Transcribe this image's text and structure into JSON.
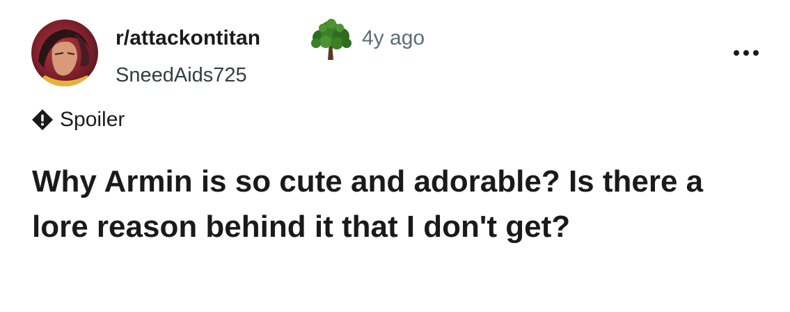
{
  "post": {
    "subreddit": "r/attackontitan",
    "flair_icon": "tree-icon",
    "age": "4y ago",
    "author": "SneedAids725",
    "menu_icon": "more-options-icon",
    "tag": {
      "icon": "exclamation-icon",
      "label": "Spoiler"
    },
    "title": "Why Armin is so cute and adorable? Is there a lore reason behind it that I don't get?"
  },
  "colors": {
    "text_primary": "#1a1a1b",
    "text_secondary": "#576f76",
    "background": "#ffffff"
  }
}
